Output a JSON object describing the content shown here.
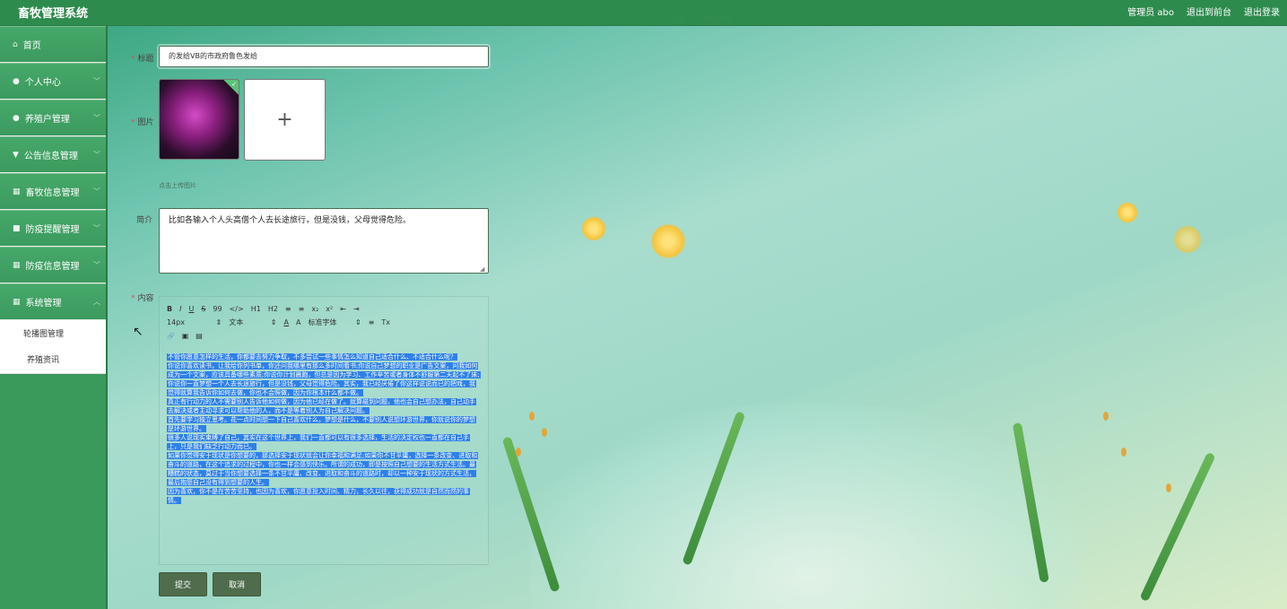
{
  "app": {
    "title": "畜牧管理系统",
    "breadcrumb": [
      "首页",
      "养殖资讯"
    ],
    "top_actions": [
      "管理员 abo",
      "退出到前台",
      "退出登录"
    ]
  },
  "sidebar": {
    "items": [
      {
        "label": "首页",
        "icon": "home-icon",
        "glyph": "⌂",
        "has_chevron": false
      },
      {
        "label": "个人中心",
        "icon": "user-icon",
        "glyph": "●",
        "has_chevron": true
      },
      {
        "label": "养殖户管理",
        "icon": "user-group-icon",
        "glyph": "●",
        "has_chevron": true
      },
      {
        "label": "公告信息管理",
        "icon": "notice-icon",
        "glyph": "▼",
        "has_chevron": true
      },
      {
        "label": "畜牧信息管理",
        "icon": "grid-icon",
        "glyph": "▦",
        "has_chevron": true
      },
      {
        "label": "防疫提醒管理",
        "icon": "bell-icon",
        "glyph": "■",
        "has_chevron": true
      },
      {
        "label": "防疫信息管理",
        "icon": "grid-icon",
        "glyph": "▦",
        "has_chevron": true
      },
      {
        "label": "系统管理",
        "icon": "grid-icon",
        "glyph": "▦",
        "has_chevron": true
      }
    ],
    "submenu": [
      "轮播图管理",
      "养殖资讯"
    ]
  },
  "form": {
    "title_label": "标题",
    "title_value": "的发给VB的市政府鲁色发给",
    "image_label": "图片",
    "upload_hint": "点击上传图片",
    "upload_plus": "+",
    "intro_label": "简介",
    "intro_value": "比如各输入个人头高僧个人去长途旅行，但是没钱，父母觉得危险。",
    "content_label": "内容",
    "toolbar_row1": [
      "B",
      "I",
      "U",
      "S",
      "99",
      "</>",
      "H1",
      "H2",
      "≡",
      "≡",
      "x₂",
      "x²",
      "⇤",
      "⇥"
    ],
    "toolbar_row2": [
      "14px",
      "文本",
      "A",
      "A",
      "标准字体",
      "≡",
      "Tx"
    ],
    "toolbar_row3": [
      "🔗",
      "▣",
      "▤"
    ],
    "content_paragraphs": [
      "不管你愿意怎样的生活，你都要去努力争取，不多尝试一些事情怎么知道自己适合什么、不适合什么呢？",
      "你说你喜欢读书，让我给你列书单，你还问我哪里有那么多时间看书;你说自己梦想的职业是广告文案，问我如何成为一个文案，应该具备哪些素质;你说你计划晨跑，但总是因为学习、工作辛苦或者身体不舒服第二天起不了床;你说你一直梦想一个人去长途旅行，但是没钱，父母觉得危险。其实，我已经厌倦了你这样说说而已的把戏，我觉得就算我告诉你如何去做，你也不会照做，因为你根本什么都不做。",
      "真正有行动力的人不需要别人告诉他如何做，因为他已经在做了。就算碰到问题，他也会自己想办法，自己动手去解决或者主动寻求可以帮助他的人，而不是等着别人为自己解决问题。",
      "首先要学习独立思考。花一点时间想一下自己喜欢什么，梦想是什么，不要别人说想环游世界，你就说你的梦想是环游世界。",
      "很多人说现实束缚了自己，其实在这个世界上，我们一直都可以有很多选择，生活的决定权也一直都在自己手上，只是我们缺乏行动力而已。",
      "如果你觉得安于现状是你想要的，那选择安于现状就会让你幸福和满足;如果你不甘平庸，选择一条改变、进取和奋斗的道路，在这个追求的过程中，你也一样会感到快乐。所谓的成功，即是按照自己想要的生活方式生活。最糟糕的状态，莫过于当你想要选择一条不甘平庸、改变、进取和奋斗的道路时，却以一种安于现状的方式生活，最后抱怨自己没有得到想要的人生。",
      "因为喜欢，你不是在苦苦坚持，也因为喜欢，你愿意投入时间、精力，长久以往，获得成功就是自然而然的事情。"
    ],
    "submit_label": "提交",
    "cancel_label": "取消"
  }
}
